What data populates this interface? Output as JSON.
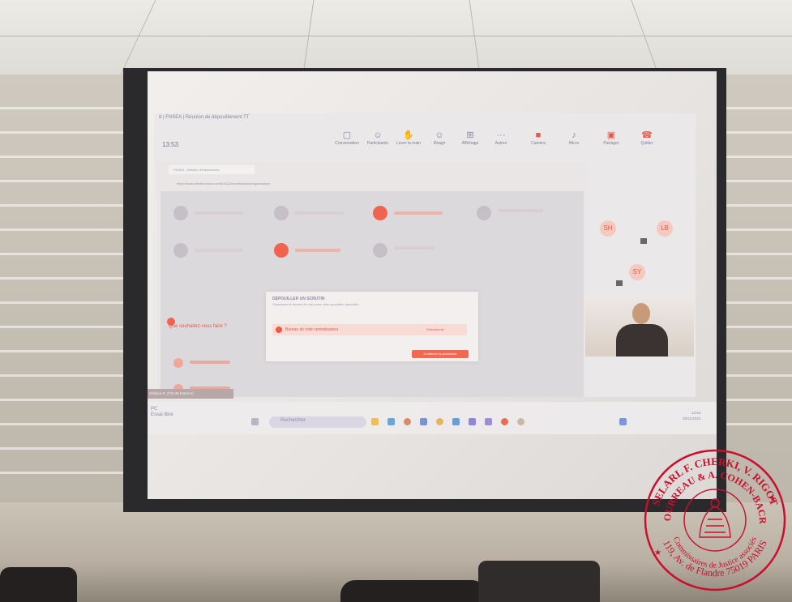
{
  "teams": {
    "window_title": "8 | FNSEA | Réunion de dépouillement TT",
    "meeting_time": "13:53",
    "toolbar": [
      {
        "label": "Conversation",
        "icon": "chat-icon"
      },
      {
        "label": "Participants",
        "icon": "people-icon"
      },
      {
        "label": "Lever la main",
        "icon": "raise-hand-icon"
      },
      {
        "label": "Réagir",
        "icon": "smile-icon"
      },
      {
        "label": "Affichage",
        "icon": "grid-icon"
      },
      {
        "label": "Autres",
        "icon": "more-icon"
      },
      {
        "label": "Caméra",
        "icon": "camera-icon"
      },
      {
        "label": "Micro",
        "icon": "mic-icon"
      },
      {
        "label": "Partager",
        "icon": "share-icon"
      },
      {
        "label": "Quitter",
        "icon": "phone-icon"
      }
    ],
    "participants": [
      "SH",
      "LB",
      "SY"
    ]
  },
  "browser": {
    "tab_title": "FNSEA - Gestion d'événements",
    "url": "https://www.electis-fnsea.com/fr/2023/events/admin/organisation/"
  },
  "modal": {
    "title": "DÉPOUILLER UN SCRUTIN",
    "subtitle": "Choisissez le bureau de vote pour vous souhaitez dépouiller",
    "option_label": "Bureau de vote centralisateur",
    "option_select": "Sélectionner",
    "confirm_label": "Confirmer la procédure"
  },
  "page": {
    "heading": "Que souhaitez-vous faire ?"
  },
  "status_bar": "Sofiane D. (FSUM Externe)",
  "taskbar": {
    "pc_label": "PC",
    "pc_sub": "Essai libre",
    "search_placeholder": "Rechercher",
    "time": "13:53",
    "date": "28/11/2023"
  },
  "stamp": {
    "line1": "SELARL F. CHERKI, V. RIGOT",
    "line2": "BOURREAU & A. COHEN-BACRI",
    "line3": "Commissaires de Justice associés",
    "line4": "119, Av. de Flandre 75019 PARIS"
  },
  "colors": {
    "accent": "#e35a47",
    "stamp": "#c8102e"
  }
}
